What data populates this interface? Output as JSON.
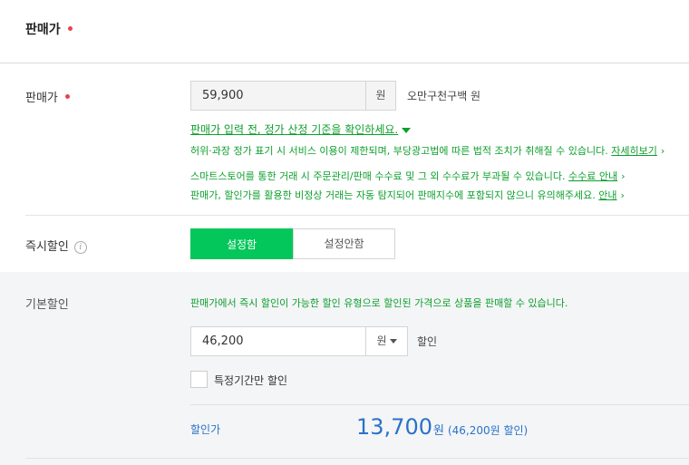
{
  "section": {
    "title": "판매가"
  },
  "price": {
    "label": "판매가",
    "value": "59,900",
    "unit": "원",
    "korean_text": "오만구천구백 원",
    "notice_link": "판매가 입력 전, 정가 산정 기준을 확인하세요.",
    "notice1_text": "허위·과장 정가 표기 시 서비스 이용이 제한되며, 부당광고법에 따른 법적 조치가 취해질 수 있습니다. ",
    "notice1_link": "자세히보기",
    "notice2_text": "스마트스토어를 통한 거래 시 주문관리/판매 수수료 및 그 외 수수료가 부과될 수 있습니다. ",
    "notice2_link": "수수료 안내",
    "notice3_text": "판매가, 할인가를 활용한 비정상 거래는 자동 탐지되어 판매지수에 포함되지 않으니 유의해주세요. ",
    "notice3_link": "안내",
    "chevron": "›"
  },
  "instant_discount": {
    "label": "즉시할인",
    "info_icon": "i",
    "on_label": "설정함",
    "off_label": "설정안함",
    "selected": "설정함"
  },
  "basic_discount": {
    "label": "기본할인",
    "description": "판매가에서 즉시 할인이 가능한 할인 유형으로 할인된 가격으로 상품을 판매할 수 있습니다.",
    "value": "46,200",
    "unit": "원",
    "suffix": "할인",
    "period_only_label": "특정기간만 할인"
  },
  "final": {
    "label": "할인가",
    "price": "13,700",
    "won": "원",
    "detail": "(46,200원 할인)"
  },
  "colors": {
    "accent_green": "#03c75a",
    "notice_green": "#0d9f2d",
    "price_blue": "#2a72c9",
    "required_red": "#e8434b"
  }
}
